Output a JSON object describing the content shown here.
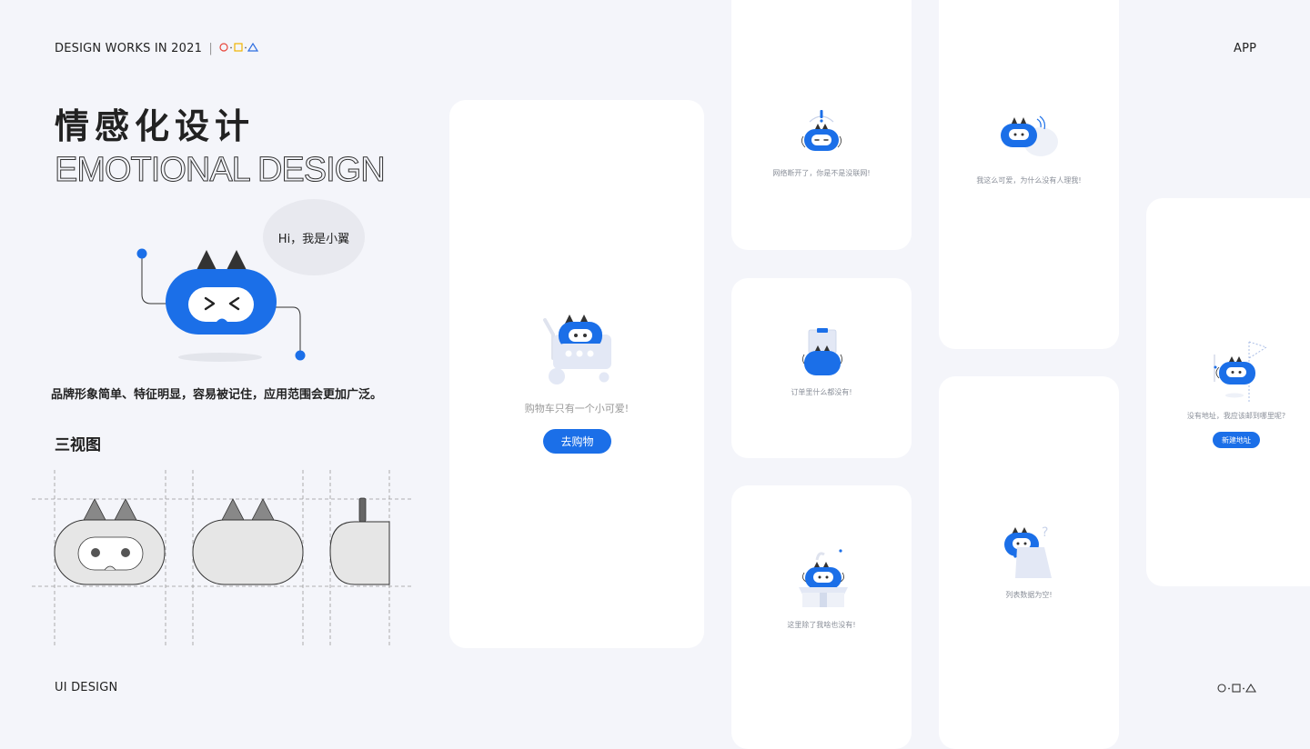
{
  "header": {
    "works": "DESIGN WORKS IN 2021",
    "app": "APP"
  },
  "footer": {
    "left": "UI DESIGN"
  },
  "hero": {
    "title_cn": "情感化设计",
    "title_en": "EMOTIONAL DESIGN",
    "greeting": "Hi，我是小翼",
    "description": "品牌形象简单、特征明显，容易被记住，应用范围会更加广泛。"
  },
  "views": {
    "title": "三视图"
  },
  "screens": {
    "cart": {
      "caption": "购物车只有一个小可爱!",
      "button": "去购物"
    },
    "offline": {
      "caption": "网络断开了，你是不是没联网!"
    },
    "orders": {
      "caption": "订单里什么都没有!"
    },
    "empty_box": {
      "caption": "这里除了我啥也没有!"
    },
    "message": {
      "caption": "我这么可爱，为什么没有人理我!"
    },
    "list": {
      "caption": "列表数据为空!"
    },
    "address": {
      "caption": "没有地址，我应该邮到哪里呢?",
      "button": "新建地址"
    }
  },
  "colors": {
    "brand_blue": "#1b6fe8",
    "background": "#f4f5fa",
    "red": "#e8463b",
    "yellow": "#f0b400",
    "blue": "#2f6fe0"
  },
  "icons": [
    "circle-icon",
    "square-icon",
    "triangle-icon",
    "robot-mascot"
  ]
}
